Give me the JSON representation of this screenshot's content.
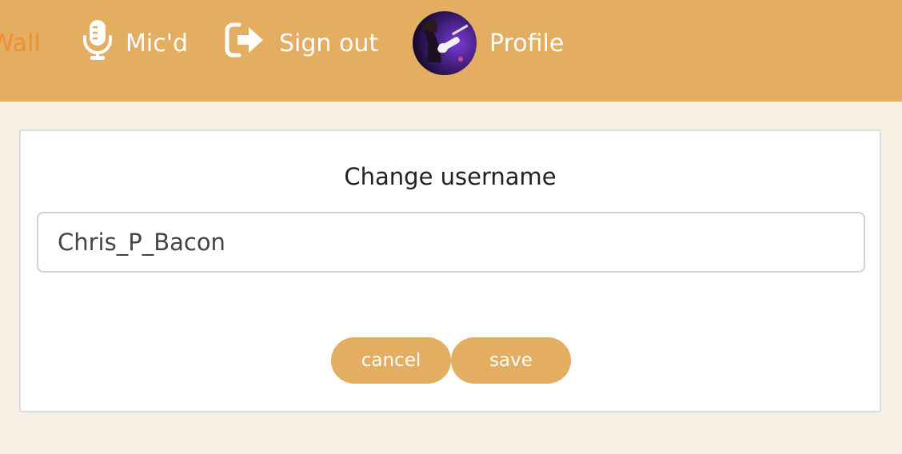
{
  "nav": {
    "wall_label": "Wall",
    "micd_label": "Mic'd",
    "signout_label": "Sign out",
    "profile_label": "Profile",
    "icons": {
      "micd": "microphone-icon",
      "signout": "sign-out-icon",
      "profile": "profile-avatar"
    }
  },
  "form": {
    "title": "Change username",
    "username_value": "Chris_P_Bacon",
    "cancel_label": "cancel",
    "save_label": "save"
  },
  "colors": {
    "navbar_bg": "#e3ae62",
    "active_link": "#f08f2e",
    "page_bg": "#f9f0e5",
    "button_bg": "#e3ae62",
    "button_text": "#ffffff"
  }
}
